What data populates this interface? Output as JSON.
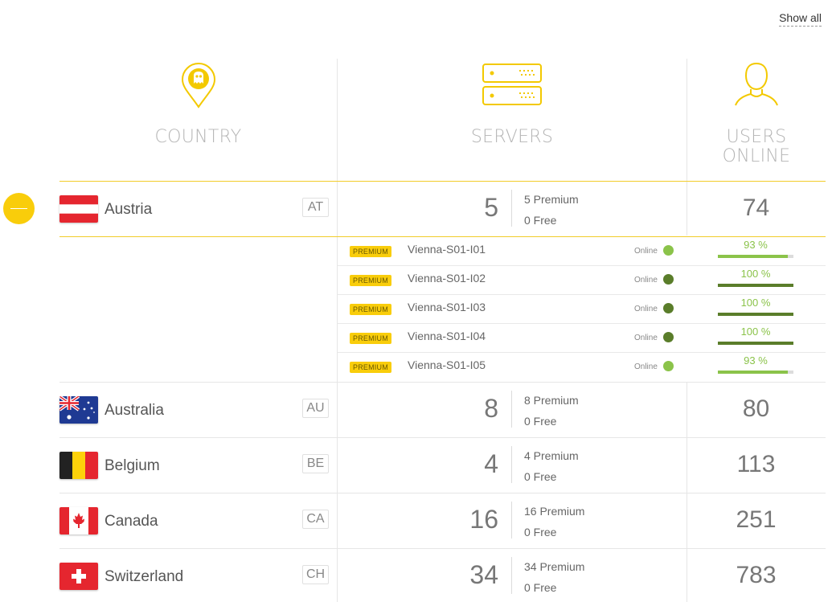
{
  "top": {
    "show_all": "Show all"
  },
  "header": {
    "country": "COUNTRY",
    "servers": "SERVERS",
    "users_line1": "USERS",
    "users_line2": "ONLINE"
  },
  "colors": {
    "accent": "#f9cd0b",
    "online_light": "#8bc34a",
    "online_dark": "#5a7d2a"
  },
  "countries": [
    {
      "name": "Austria",
      "code": "AT",
      "servers": "5",
      "premium": "5 Premium",
      "free": "0 Free",
      "users": "74",
      "expanded": true
    },
    {
      "name": "Australia",
      "code": "AU",
      "servers": "8",
      "premium": "8 Premium",
      "free": "0 Free",
      "users": "80"
    },
    {
      "name": "Belgium",
      "code": "BE",
      "servers": "4",
      "premium": "4 Premium",
      "free": "0 Free",
      "users": "113"
    },
    {
      "name": "Canada",
      "code": "CA",
      "servers": "16",
      "premium": "16 Premium",
      "free": "0 Free",
      "users": "251"
    },
    {
      "name": "Switzerland",
      "code": "CH",
      "servers": "34",
      "premium": "34 Premium",
      "free": "0 Free",
      "users": "783"
    }
  ],
  "austria_servers": [
    {
      "badge": "PREMIUM",
      "name": "Vienna-S01-I01",
      "status": "Online",
      "load_label": "93 %",
      "load": 0.93
    },
    {
      "badge": "PREMIUM",
      "name": "Vienna-S01-I02",
      "status": "Online",
      "load_label": "100 %",
      "load": 1.0
    },
    {
      "badge": "PREMIUM",
      "name": "Vienna-S01-I03",
      "status": "Online",
      "load_label": "100 %",
      "load": 1.0
    },
    {
      "badge": "PREMIUM",
      "name": "Vienna-S01-I04",
      "status": "Online",
      "load_label": "100 %",
      "load": 1.0
    },
    {
      "badge": "PREMIUM",
      "name": "Vienna-S01-I05",
      "status": "Online",
      "load_label": "93 %",
      "load": 0.93
    }
  ]
}
